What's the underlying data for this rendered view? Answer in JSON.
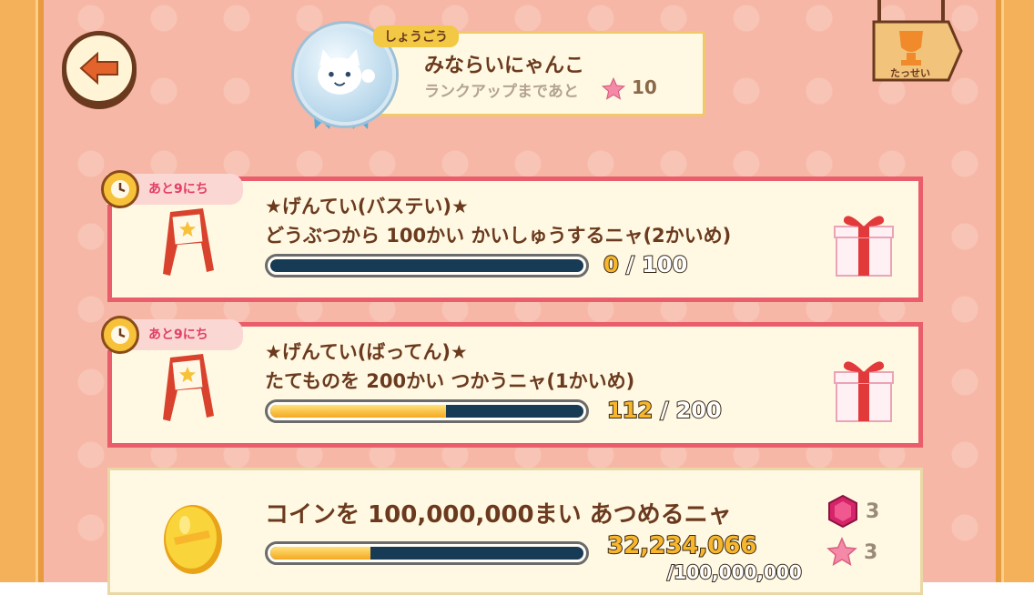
{
  "header": {
    "title_tag": "しょうごう",
    "title_name": "みならいにゃんこ",
    "rank_up_label": "ランクアップまであと",
    "rank_up_count": "10",
    "achievement_label": "たっせい"
  },
  "missions": [
    {
      "days_left": "あと9にち",
      "title": "★げんてい(バステい)★",
      "description": "どうぶつから 100かい かいしゅうするニャ(2かいめ)",
      "current": "0",
      "separator": " / ",
      "total": "100",
      "progress": 0
    },
    {
      "days_left": "あと9にち",
      "title": "★げんてい(ばってん)★",
      "description": "たてものを 200かい つかうニャ(1かいめ)",
      "current": "112",
      "separator": " / ",
      "total": "200",
      "progress": 0.56
    }
  ],
  "coin_mission": {
    "title": "コインを 100,000,000まい あつめるニャ",
    "current": "32,234,066",
    "total": "/100,000,000",
    "progress": 0.32,
    "reward_gem_count": "3",
    "reward_star_count": "3"
  },
  "colors": {
    "background": "#f7b7a6",
    "mission_border": "#ea5d6a",
    "text_brown": "#6b3a1e",
    "progress_fill": "#f5a820",
    "progress_track": "#173a55"
  }
}
